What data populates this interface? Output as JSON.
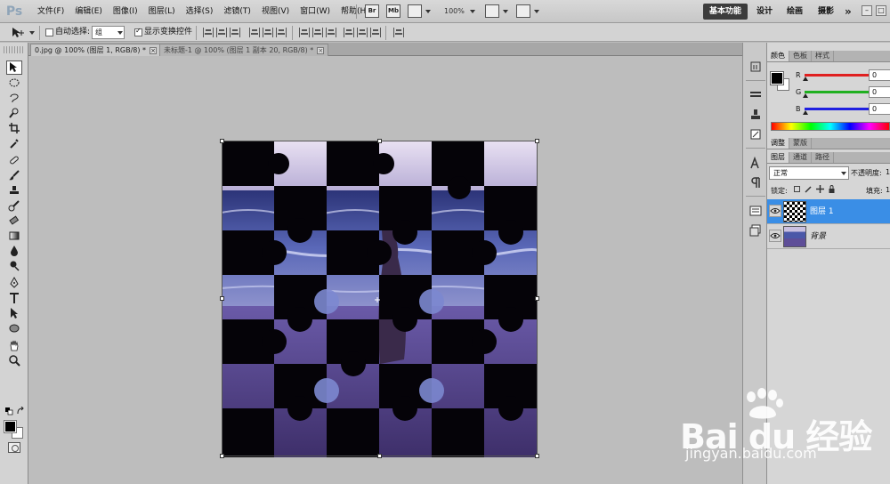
{
  "app": {
    "logo_text": "Ps"
  },
  "menubar": {
    "items": [
      "文件(F)",
      "编辑(E)",
      "图像(I)",
      "图层(L)",
      "选择(S)",
      "滤镜(T)",
      "视图(V)",
      "窗口(W)",
      "帮助(H)"
    ],
    "zoom": "100%",
    "icon_br": "Br",
    "icon_mb": "Mb",
    "workspaces": {
      "active": "基本功能",
      "items": [
        "设计",
        "绘画",
        "摄影"
      ],
      "more": "»"
    }
  },
  "options": {
    "auto_select_label": "自动选择:",
    "auto_select_checked": false,
    "auto_select_value": "组",
    "show_transform_label": "显示变换控件",
    "show_transform_checked": true
  },
  "tabs": [
    {
      "title": "0.jpg @ 100% (图层 1, RGB/8) *",
      "active": true,
      "close": "×"
    },
    {
      "title": "未标题-1 @ 100% (图层 1 副本 20, RGB/8) *",
      "active": false,
      "close": "×"
    }
  ],
  "color_panel": {
    "tabs": [
      "颜色",
      "色板",
      "样式"
    ],
    "channels": [
      {
        "label": "R",
        "value": "0",
        "color": "#e02020"
      },
      {
        "label": "G",
        "value": "0",
        "color": "#20b020"
      },
      {
        "label": "B",
        "value": "0",
        "color": "#2020e0"
      }
    ]
  },
  "adjust_panel": {
    "tabs": [
      "调整",
      "蒙版"
    ]
  },
  "layers_panel": {
    "tabs": [
      "图层",
      "通道",
      "路径"
    ],
    "blend_mode": "正常",
    "opacity_label": "不透明度:",
    "opacity_value": "1",
    "lock_label": "锁定:",
    "fill_label": "填充:",
    "fill_value": "1",
    "layers": [
      {
        "name": "图层 1",
        "selected": true
      },
      {
        "name": "背景",
        "selected": false
      }
    ]
  },
  "watermark": {
    "brand": "Bai du 经验",
    "url": "jingyan.baidu.com"
  },
  "colors": {
    "selection": "#3a8ee6",
    "puzzle_tint": "#6a5aa8"
  }
}
